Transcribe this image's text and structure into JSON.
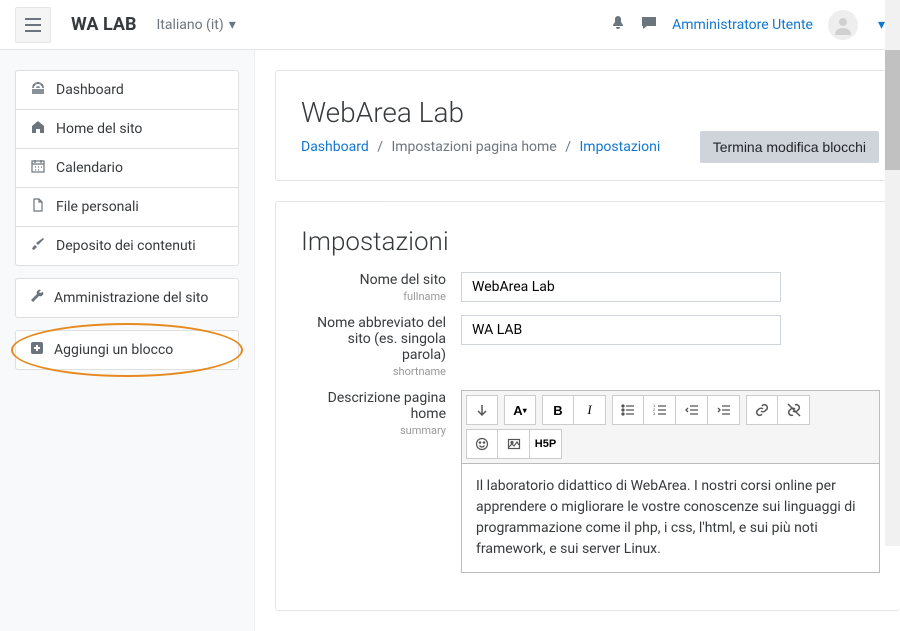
{
  "navbar": {
    "brand": "WA LAB",
    "language": "Italiano (it)",
    "username": "Amministratore Utente"
  },
  "sidebar": {
    "items": [
      {
        "icon": "dashboard",
        "label": "Dashboard"
      },
      {
        "icon": "home",
        "label": "Home del sito"
      },
      {
        "icon": "calendar",
        "label": "Calendario"
      },
      {
        "icon": "file",
        "label": "File personali"
      },
      {
        "icon": "paintbrush",
        "label": "Deposito dei contenuti"
      }
    ],
    "admin": {
      "label": "Amministrazione del sito"
    },
    "add_block": {
      "label": "Aggiungi un blocco"
    }
  },
  "header": {
    "title": "WebArea Lab",
    "breadcrumb": {
      "dashboard": "Dashboard",
      "settings_page": "Impostazioni pagina home",
      "settings": "Impostazioni"
    },
    "end_edit_button": "Termina modifica blocchi"
  },
  "settings": {
    "heading": "Impostazioni",
    "site_name": {
      "label": "Nome del sito",
      "sub": "fullname",
      "value": "WebArea Lab"
    },
    "short_name": {
      "label": "Nome abbreviato del sito (es. singola parola)",
      "sub": "shortname",
      "value": "WA LAB"
    },
    "description": {
      "label": "Descrizione pagina home",
      "sub": "summary",
      "content": "Il laboratorio didattico di WebArea. I nostri corsi online per apprendere o migliorare le vostre conoscenze sui linguaggi di programmazione come il php, i css, l'html, e sui più noti framework, e sui server Linux."
    }
  }
}
